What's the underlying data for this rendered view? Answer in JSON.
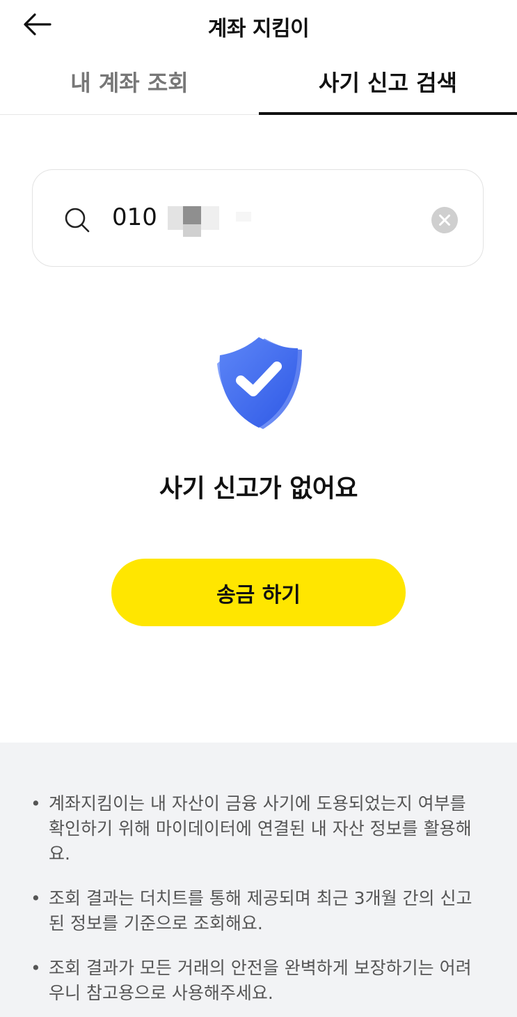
{
  "header": {
    "back_icon": "arrow-left-icon",
    "title": "계좌 지킴이"
  },
  "tabs": [
    {
      "label": "내 계좌 조회",
      "active": false
    },
    {
      "label": "사기 신고 검색",
      "active": true
    }
  ],
  "search": {
    "icon": "search-icon",
    "value": "010",
    "value_masked": true,
    "clear_icon": "clear-circle-icon"
  },
  "result": {
    "icon": "shield-check-icon",
    "message": "사기 신고가 없어요"
  },
  "send_button": {
    "label": "송금 하기"
  },
  "notices": [
    {
      "bullet": "•",
      "text": "계좌지킴이는 내 자산이 금융 사기에 도용되었는지 여부를 확인하기 위해 마이데이터에 연결된 내 자산 정보를 활용해요."
    },
    {
      "bullet": "•",
      "text": "조회 결과는 더치트를 통해 제공되며 최근 3개월 간의 신고된 정보를 기준으로 조회해요."
    },
    {
      "bullet": "•",
      "text": "조회 결과가 모든 거래의 안전을 완벽하게 보장하기는 어려우니 참고용으로 사용해주세요."
    }
  ],
  "colors": {
    "accent_yellow": "#ffe600",
    "shield_blue": "#3f6df0",
    "notice_bg": "#f2f3f5",
    "tab_active": "#111111",
    "tab_inactive": "#777777"
  }
}
